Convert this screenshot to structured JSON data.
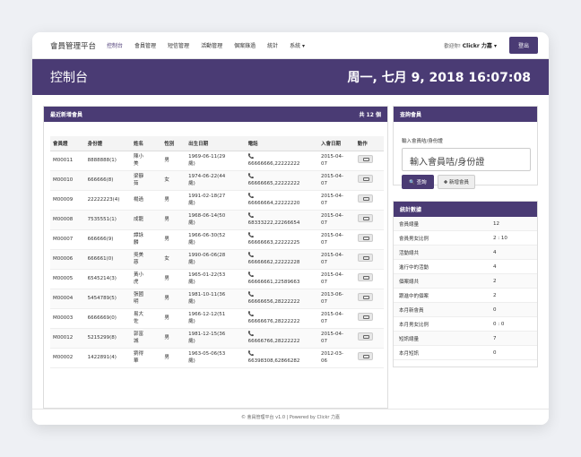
{
  "navbar": {
    "brand": "會員管理平台",
    "items": [
      "控制台",
      "會員管理",
      "短信管理",
      "活動管理",
      "個案錄過",
      "統計",
      "系統 ▾"
    ],
    "welcome_prefix": "歡迎你!",
    "user": "Clickr 力嘉 ▾",
    "logout": "登出"
  },
  "header": {
    "title": "控制台",
    "date": "周一, 七月 9, 2018 16:07:08"
  },
  "members_panel": {
    "title": "最近新增會員",
    "count": "共 12 個",
    "columns": [
      "會員證",
      "身份證",
      "姓名",
      "性別",
      "出生日期",
      "電話",
      "入會日期",
      "動作"
    ],
    "rows": [
      {
        "id": "M00011",
        "idcard": "8888888(1)",
        "name": "陳小\n美",
        "gender": "男",
        "birth": "1969-06-11(29\n歲)",
        "phone": "66666666,22222222",
        "join": "2015-04-\n07"
      },
      {
        "id": "M00010",
        "idcard": "666666(8)",
        "name": "梁靜\n茹",
        "gender": "女",
        "birth": "1974-06-22(44\n歲)",
        "phone": "66666665,22222222",
        "join": "2015-04-\n07"
      },
      {
        "id": "M00009",
        "idcard": "22222223(4)",
        "name": "楊過",
        "gender": "男",
        "birth": "1991-02-18(27\n歲)",
        "phone": "66666664,22222220",
        "join": "2015-04-\n07"
      },
      {
        "id": "M00008",
        "idcard": "7535551(1)",
        "name": "成龍",
        "gender": "男",
        "birth": "1968-06-14(50\n歲)",
        "phone": "68333222,22266654",
        "join": "2015-04-\n07"
      },
      {
        "id": "M00007",
        "idcard": "666666(9)",
        "name": "譚詠\n麟",
        "gender": "男",
        "birth": "1966-06-30(52\n歲)",
        "phone": "66666663,22222225",
        "join": "2015-04-\n07"
      },
      {
        "id": "M00006",
        "idcard": "666661(0)",
        "name": "吳美\n慈",
        "gender": "女",
        "birth": "1990-06-06(28\n歲)",
        "phone": "66666662,22222228",
        "join": "2015-04-\n07"
      },
      {
        "id": "M00005",
        "idcard": "6545214(3)",
        "name": "黃小\n虎",
        "gender": "男",
        "birth": "1965-01-22(53\n歲)",
        "phone": "66666661,22589663",
        "join": "2015-04-\n07"
      },
      {
        "id": "M00004",
        "idcard": "5454789(5)",
        "name": "張國\n明",
        "gender": "男",
        "birth": "1981-10-11(36\n歲)",
        "phone": "66666656,28222222",
        "join": "2013-06-\n07"
      },
      {
        "id": "M00003",
        "idcard": "6666669(0)",
        "name": "易大\n佐",
        "gender": "男",
        "birth": "1966-12-12(51\n歲)",
        "phone": "66666676,28222222",
        "join": "2015-04-\n07"
      },
      {
        "id": "M00012",
        "idcard": "5215299(8)",
        "name": "郭富\n城",
        "gender": "男",
        "birth": "1981-12-15(36\n歲)",
        "phone": "66666766,28222222",
        "join": "2015-04-\n07"
      },
      {
        "id": "M00002",
        "idcard": "1422891(4)",
        "name": "劉得\n華",
        "gender": "男",
        "birth": "1963-05-06(53\n歲)",
        "phone": "66398308,62866282",
        "join": "2012-03-\n06"
      }
    ]
  },
  "query_panel": {
    "title": "查詢會員",
    "label": "輸入會員咭/身份證",
    "placeholder": "輸入會員咭/身份證",
    "search_button": "查詢",
    "add_button": "新增會員"
  },
  "stats_panel": {
    "title": "統計數據",
    "rows": [
      {
        "k": "會員總量",
        "v": "12"
      },
      {
        "k": "會員男女比例",
        "v": "2 : 10"
      },
      {
        "k": "活動總共",
        "v": "4"
      },
      {
        "k": "進行中的活動",
        "v": "4"
      },
      {
        "k": "個案總共",
        "v": "2"
      },
      {
        "k": "跟進中的個案",
        "v": "2"
      },
      {
        "k": "本月新會員",
        "v": "0"
      },
      {
        "k": "本月男女比例",
        "v": "0 : 0"
      },
      {
        "k": "短訊總量",
        "v": "7"
      },
      {
        "k": "本月短訊",
        "v": "0"
      }
    ]
  },
  "footer": "© 會員管理平台 v1.0 | Powered by Clickr 力嘉"
}
